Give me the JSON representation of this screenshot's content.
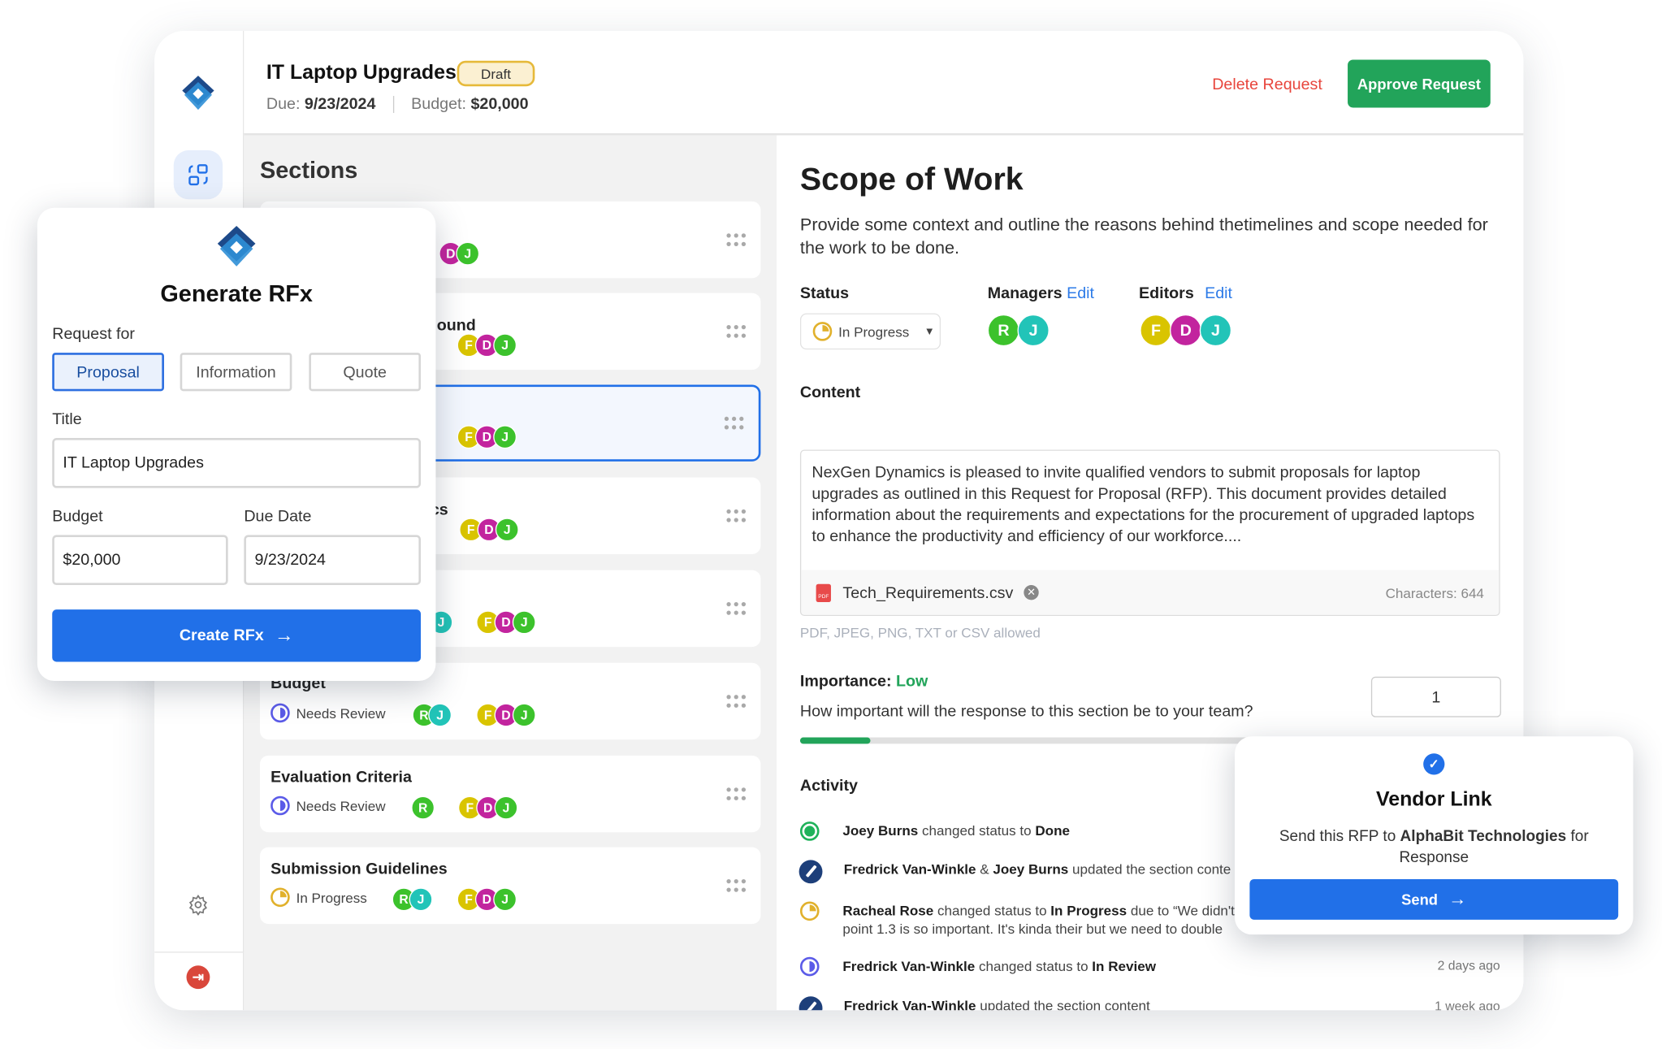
{
  "header": {
    "title": "IT Laptop Upgrades",
    "badge": "Draft",
    "due_label": "Due:",
    "due_value": "9/23/2024",
    "budget_label": "Budget:",
    "budget_value": "$20,000",
    "delete_label": "Delete Request",
    "approve_label": "Approve Request"
  },
  "sidebar": {
    "icons": [
      "logo-icon",
      "sections-icon",
      "gear-icon",
      "logout-icon"
    ]
  },
  "sections": {
    "heading": "Sections",
    "cards": [
      {
        "title": "",
        "status": ""
      },
      {
        "title": "ound",
        "status": ""
      },
      {
        "title": "",
        "status": ""
      },
      {
        "title": "cs",
        "status": ""
      },
      {
        "title": "",
        "status": ""
      },
      {
        "title": "Budget",
        "status": "Needs Review"
      },
      {
        "title": "Evaluation Criteria",
        "status": "Needs Review"
      },
      {
        "title": "Submission Guidelines",
        "status": "In Progress"
      }
    ],
    "selected_index": 2
  },
  "avatars": {
    "F": "F",
    "D": "D",
    "J": "J",
    "R": "R"
  },
  "colors": {
    "F": "#d9c400",
    "D": "#c2249e",
    "J_green": "#3cc22c",
    "J_teal": "#22c4b8",
    "R": "#3cc22c",
    "accent": "#2170e8",
    "approve": "#22a45a",
    "delete": "#e8453c"
  },
  "detail": {
    "title": "Scope of Work",
    "description": "Provide some context and outline the reasons behind thetimelines and scope needed for the work to be done.",
    "status_label": "Status",
    "status_value": "In Progress",
    "managers_label": "Managers",
    "editors_label": "Editors",
    "edit_label": "Edit",
    "content_label": "Content",
    "content_text": "NexGen Dynamics is pleased to invite qualified vendors to submit proposals for laptop upgrades as outlined in this Request for Proposal (RFP). This document provides detailed information about the requirements and expectations for the procurement of upgraded laptops to enhance the productivity and efficiency of our workforce....",
    "attachment": "Tech_Requirements.csv",
    "characters": "Characters: 644",
    "hint": "PDF, JPEG, PNG, TXT or CSV allowed",
    "importance_label": "Importance:",
    "importance_value": "Low",
    "importance_question": "How important will the response to this section be to your team?",
    "importance_input": "1",
    "importance_progress_pct": 10,
    "activity_label": "Activity",
    "activity": [
      {
        "icon": "done",
        "who": "Joey Burns",
        "text": " changed status to ",
        "target": "Done",
        "time": ""
      },
      {
        "icon": "edit",
        "who": "Fredrick Van-Winkle",
        "text": " & ",
        "who2": "Joey Burns",
        "text2": " updated the section conte",
        "time": ""
      },
      {
        "icon": "progress",
        "who": "Racheal Rose",
        "text": " changed status to ",
        "target": "In Progress",
        "text2": " due to “We didn't",
        "line2": "point 1.3 is so important. It's kinda their but we need to double",
        "time": ""
      },
      {
        "icon": "review",
        "who": "Fredrick Van-Winkle",
        "text": " changed status to ",
        "target": "In Review",
        "time": "2 days ago"
      },
      {
        "icon": "edit",
        "who": "Fredrick Van-Winkle",
        "text": " updated the section content",
        "time": "1 week ago"
      }
    ]
  },
  "generate": {
    "title": "Generate RFx",
    "request_for_label": "Request for",
    "options": [
      "Proposal",
      "Information",
      "Quote"
    ],
    "selected_option": "Proposal",
    "title_label": "Title",
    "title_value": "IT Laptop Upgrades",
    "budget_label": "Budget",
    "budget_value": "$20,000",
    "due_label": "Due Date",
    "due_value": "9/23/2024",
    "create_label": "Create RFx"
  },
  "vendor": {
    "title": "Vendor Link",
    "text_pre": "Send this RFP to ",
    "company": "AlphaBit Technologies",
    "text_post": " for Response",
    "send_label": "Send"
  }
}
